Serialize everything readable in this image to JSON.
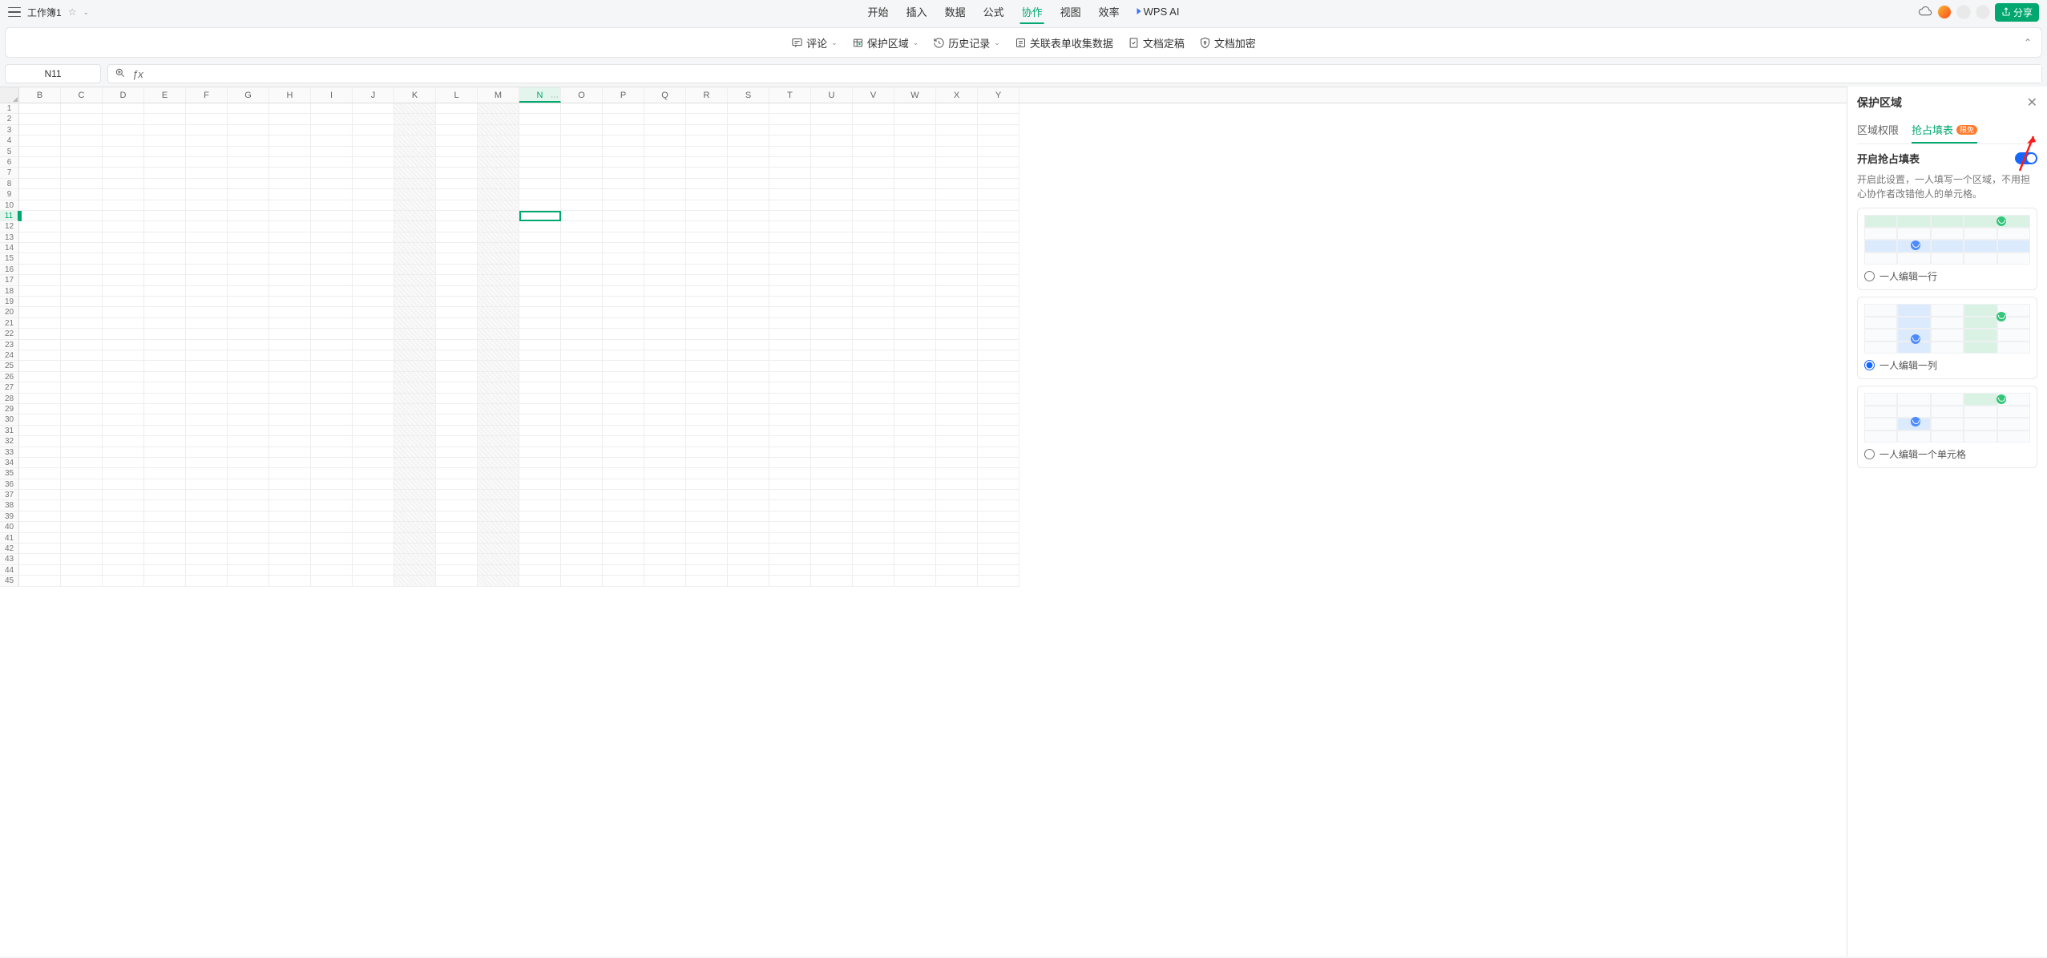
{
  "title": "工作簿1",
  "menus": {
    "start": "开始",
    "insert": "插入",
    "data": "数据",
    "formula": "公式",
    "collab": "协作",
    "view": "视图",
    "efficiency": "效率",
    "wpsai": "WPS AI"
  },
  "share": "分享",
  "ribbon": {
    "comment": "评论",
    "protect": "保护区域",
    "history": "历史记录",
    "linkform": "关联表单收集数据",
    "finalize": "文档定稿",
    "encrypt": "文档加密"
  },
  "cellRef": "N11",
  "formula": "",
  "columns": [
    "B",
    "C",
    "D",
    "E",
    "F",
    "G",
    "H",
    "I",
    "J",
    "K",
    "L",
    "M",
    "N",
    "O",
    "P",
    "Q",
    "R",
    "S",
    "T",
    "U",
    "V",
    "W",
    "X",
    "Y"
  ],
  "shadedCols": [
    "K",
    "M"
  ],
  "selectedCol": "N",
  "selectedRow": 11,
  "rowCount": 45,
  "panel": {
    "title": "保护区域",
    "tab_area": "区域权限",
    "tab_fill": "抢占填表",
    "badge": "限免",
    "toggle_label": "开启抢占填表",
    "desc": "开启此设置，一人填写一个区域，不用担心协作者改错他人的单元格。",
    "opt_row": "一人编辑一行",
    "opt_col": "一人编辑一列",
    "opt_cell": "一人编辑一个单元格"
  }
}
